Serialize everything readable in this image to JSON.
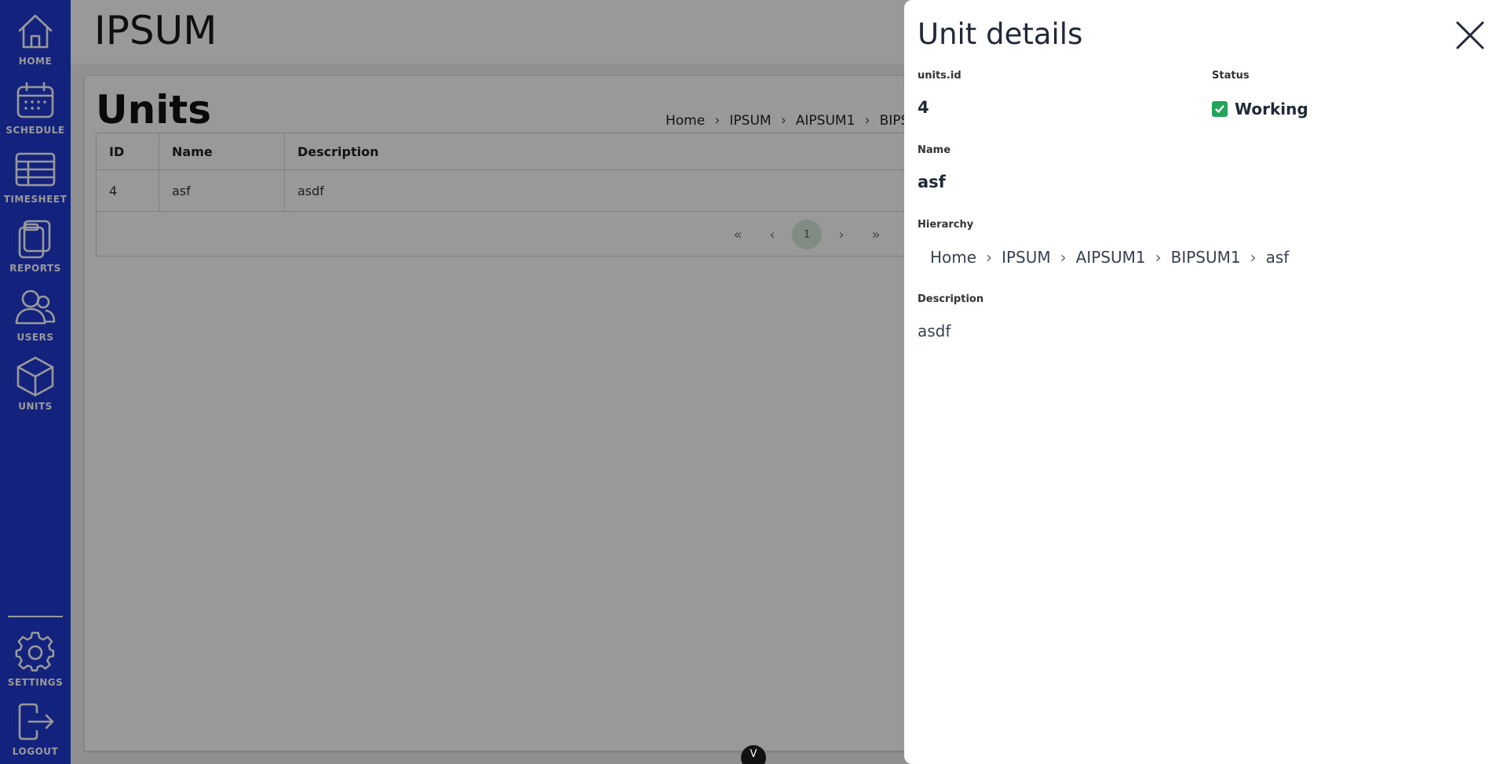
{
  "sidebar": {
    "items": [
      {
        "label": "HOME",
        "icon": "home-icon"
      },
      {
        "label": "SCHEDULE",
        "icon": "calendar-icon"
      },
      {
        "label": "TIMESHEET",
        "icon": "table-icon"
      },
      {
        "label": "REPORTS",
        "icon": "clipboard-icon"
      },
      {
        "label": "USERS",
        "icon": "users-icon"
      },
      {
        "label": "UNITS",
        "icon": "cube-icon"
      }
    ],
    "bottom": [
      {
        "label": "SETTINGS",
        "icon": "gear-icon"
      },
      {
        "label": "LOGOUT",
        "icon": "logout-icon"
      }
    ],
    "color": "#1f3ad1"
  },
  "header": {
    "app_title": "IPSUM"
  },
  "page": {
    "title": "Units",
    "breadcrumb": [
      "Home",
      "IPSUM",
      "AIPSUM1",
      "BIPSU"
    ]
  },
  "table": {
    "columns": [
      "ID",
      "Name",
      "Description"
    ],
    "rows": [
      [
        "4",
        "asf",
        "asdf"
      ]
    ],
    "pagination": {
      "first": "«",
      "prev": "‹",
      "current": "1",
      "next": "›",
      "last": "»"
    }
  },
  "scroll_handle": {
    "label": "V"
  },
  "drawer": {
    "title": "Unit details",
    "id_label": "units.id",
    "id_value": "4",
    "status_label": "Status",
    "status_value": "Working",
    "status_color": "#22a55a",
    "name_label": "Name",
    "name_value": "asf",
    "hierarchy_label": "Hierarchy",
    "hierarchy": [
      "Home",
      "IPSUM",
      "AIPSUM1",
      "BIPSUM1",
      "asf"
    ],
    "description_label": "Description",
    "description_value": "asdf"
  }
}
